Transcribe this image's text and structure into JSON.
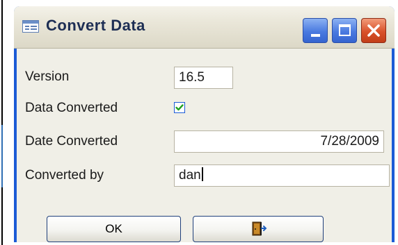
{
  "window": {
    "title": "Convert Data",
    "title_icon": "form-icon",
    "controls": [
      "minimize-icon",
      "maximize-icon",
      "close-icon"
    ]
  },
  "form": {
    "version": {
      "label": "Version",
      "value": "16.5"
    },
    "data_converted": {
      "label": "Data Converted",
      "checked": true
    },
    "date_converted": {
      "label": "Date Converted",
      "value": "7/28/2009"
    },
    "converted_by": {
      "label": "Converted by",
      "value": "dan"
    }
  },
  "buttons": {
    "ok_label": "OK",
    "exit_icon": "exit-door-icon"
  },
  "colors": {
    "titlebar_frame": "#1c5bd6",
    "close_button": "#d9512a",
    "check": "#21a121",
    "dialog_bg": "#f0efe7"
  }
}
